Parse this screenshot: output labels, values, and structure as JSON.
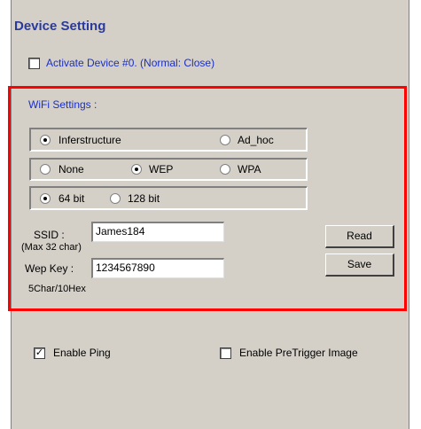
{
  "title": "Device Setting",
  "activate": {
    "label": "Activate Device #0. (Normal: Close)",
    "checked": false
  },
  "wifi": {
    "heading": "WiFi Settings :",
    "mode": {
      "options": [
        "Inferstructure",
        "Ad_hoc"
      ],
      "selected": "Inferstructure"
    },
    "security": {
      "options": [
        "None",
        "WEP",
        "WPA"
      ],
      "selected": "WEP"
    },
    "bits": {
      "options": [
        "64 bit",
        "128 bit"
      ],
      "selected": "64 bit"
    },
    "ssid_label": "SSID :",
    "ssid_note": "(Max 32 char)",
    "ssid_value": "James184",
    "wepkey_label": "Wep Key :",
    "wepkey_value": "1234567890",
    "wepkey_note": "5Char/10Hex",
    "read_label": "Read",
    "save_label": "Save"
  },
  "enable_ping": {
    "label": "Enable Ping",
    "checked": true,
    "mark": "✓"
  },
  "enable_pretrigger": {
    "label": "Enable PreTrigger Image",
    "checked": false
  },
  "colors": {
    "title": "#2a3a9c",
    "highlight": "#ff0000",
    "panel": "#d4d0c8"
  }
}
